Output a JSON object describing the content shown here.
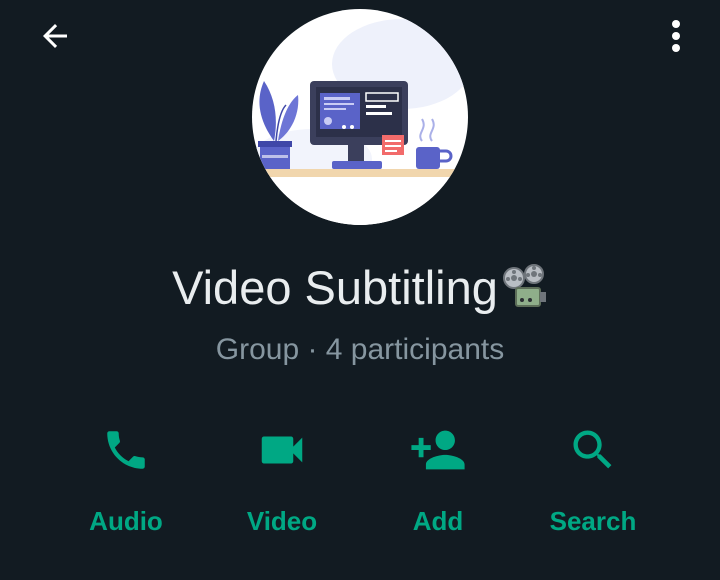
{
  "header": {
    "back_icon": "arrow-left-icon",
    "menu_icon": "more-vertical-icon"
  },
  "profile": {
    "avatar_icon": "workspace-illustration",
    "name": "Video Subtitling",
    "name_emoji_icon": "film-projector-icon",
    "subtitle": "Group · 4 participants"
  },
  "actions": [
    {
      "label": "Audio",
      "icon": "phone-icon"
    },
    {
      "label": "Video",
      "icon": "video-camera-icon"
    },
    {
      "label": "Add",
      "icon": "add-person-icon"
    },
    {
      "label": "Search",
      "icon": "search-icon"
    }
  ],
  "colors": {
    "background": "#121b22",
    "accent": "#00a884",
    "primary_text": "#e9edef",
    "secondary_text": "#8696a0"
  }
}
